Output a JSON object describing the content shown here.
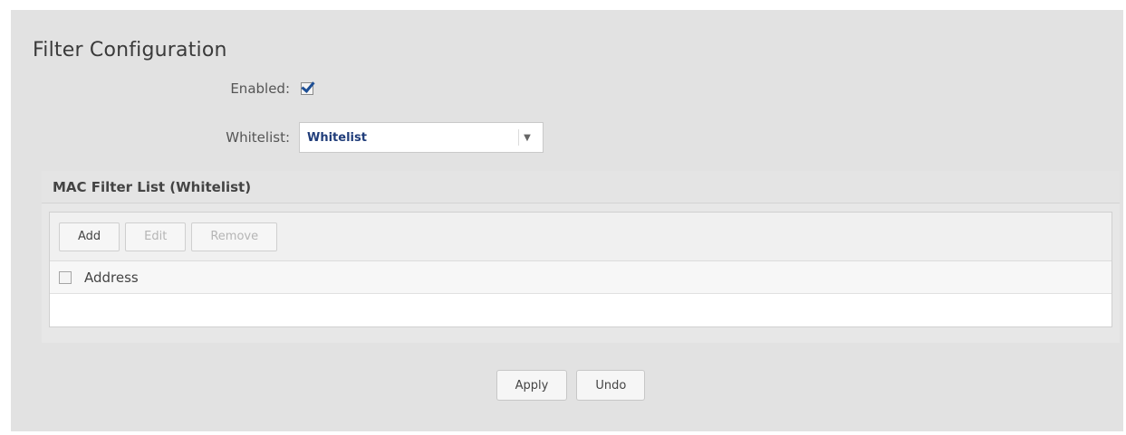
{
  "title": "Filter Configuration",
  "form": {
    "enabled_label": "Enabled:",
    "enabled_checked": true,
    "list_label": "Whitelist:",
    "list_value": "Whitelist"
  },
  "group": {
    "title": "MAC Filter List (Whitelist)",
    "toolbar": {
      "add": "Add",
      "edit": "Edit",
      "remove": "Remove"
    },
    "columns": [
      "Address"
    ]
  },
  "actions": {
    "apply": "Apply",
    "undo": "Undo"
  },
  "icons": {
    "select_arrow": "chevron-down-icon",
    "checkbox_checked": "checkmark-icon"
  },
  "colors": {
    "panel_bg": "#e2e2e2",
    "select_text": "#203d7a",
    "check_mark": "#1e4f95"
  }
}
